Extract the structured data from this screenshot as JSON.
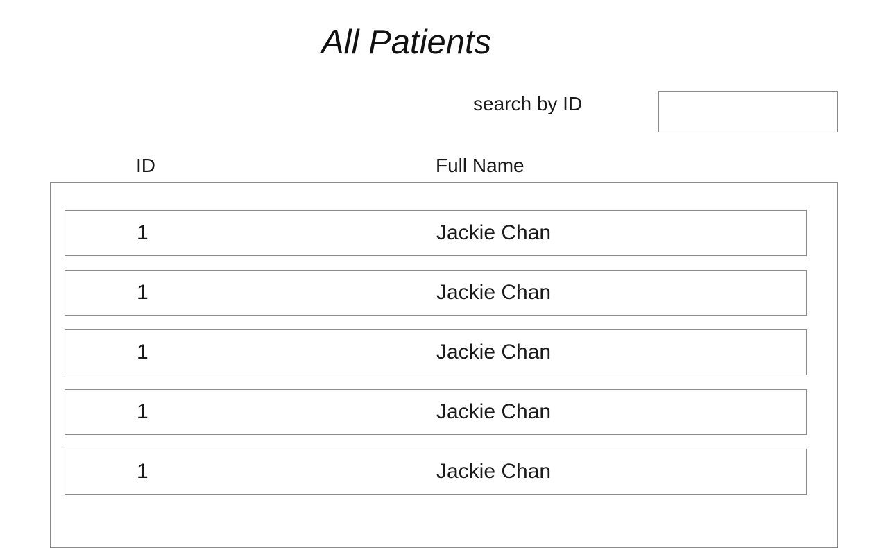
{
  "page": {
    "title": "All Patients"
  },
  "search": {
    "label": "search by ID",
    "value": "",
    "placeholder": ""
  },
  "table": {
    "columns": [
      "ID",
      "Full Name"
    ],
    "rows": [
      {
        "id": "1",
        "full_name": "Jackie Chan"
      },
      {
        "id": "1",
        "full_name": "Jackie Chan"
      },
      {
        "id": "1",
        "full_name": "Jackie Chan"
      },
      {
        "id": "1",
        "full_name": "Jackie Chan"
      },
      {
        "id": "1",
        "full_name": "Jackie Chan"
      }
    ]
  }
}
